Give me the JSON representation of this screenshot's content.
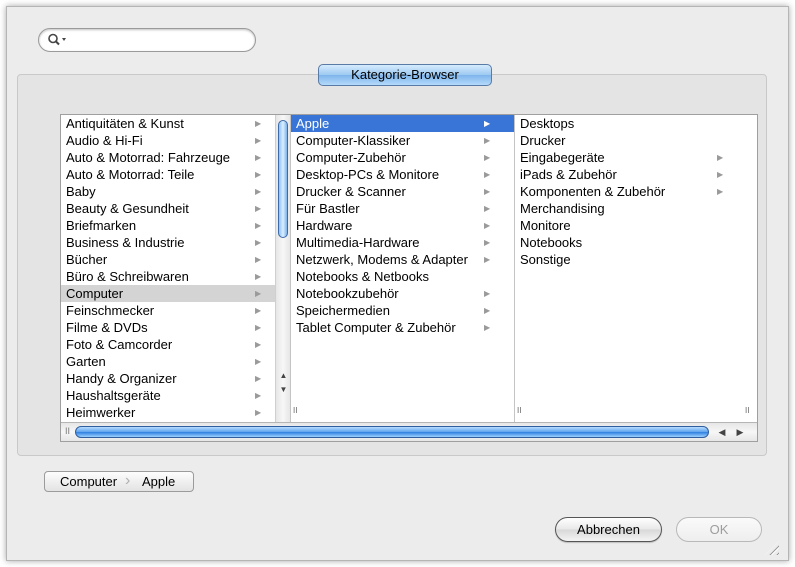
{
  "search": {
    "placeholder": "",
    "value": ""
  },
  "groupbox": {
    "title": "Kategorie-Browser"
  },
  "columns": {
    "col1": [
      {
        "label": "Antiquitäten & Kunst",
        "arrow": "▶"
      },
      {
        "label": "Audio & Hi-Fi",
        "arrow": "▶"
      },
      {
        "label": "Auto & Motorrad: Fahrzeuge",
        "arrow": "▶"
      },
      {
        "label": "Auto & Motorrad: Teile",
        "arrow": "▶"
      },
      {
        "label": "Baby",
        "arrow": "▶"
      },
      {
        "label": "Beauty & Gesundheit",
        "arrow": "▶"
      },
      {
        "label": "Briefmarken",
        "arrow": "▶"
      },
      {
        "label": "Business & Industrie",
        "arrow": "▶"
      },
      {
        "label": "Bücher",
        "arrow": "▶"
      },
      {
        "label": "Büro & Schreibwaren",
        "arrow": "▶"
      },
      {
        "label": "Computer",
        "arrow": "▶"
      },
      {
        "label": "Feinschmecker",
        "arrow": "▶"
      },
      {
        "label": "Filme & DVDs",
        "arrow": "▶"
      },
      {
        "label": "Foto & Camcorder",
        "arrow": "▶"
      },
      {
        "label": "Garten",
        "arrow": "▶"
      },
      {
        "label": "Handy & Organizer",
        "arrow": "▶"
      },
      {
        "label": "Haushaltsgeräte",
        "arrow": "▶"
      },
      {
        "label": "Heimwerker",
        "arrow": "▶"
      }
    ],
    "col2": [
      {
        "label": "Apple",
        "arrow": "▶"
      },
      {
        "label": "Computer-Klassiker",
        "arrow": "▶"
      },
      {
        "label": "Computer-Zubehör",
        "arrow": "▶"
      },
      {
        "label": "Desktop-PCs & Monitore",
        "arrow": "▶"
      },
      {
        "label": "Drucker & Scanner",
        "arrow": "▶"
      },
      {
        "label": "Für Bastler",
        "arrow": "▶"
      },
      {
        "label": "Hardware",
        "arrow": "▶"
      },
      {
        "label": "Multimedia-Hardware",
        "arrow": "▶"
      },
      {
        "label": "Netzwerk, Modems & Adapter",
        "arrow": "▶"
      },
      {
        "label": "Notebooks & Netbooks",
        "arrow": ""
      },
      {
        "label": "Notebookzubehör",
        "arrow": "▶"
      },
      {
        "label": "Speichermedien",
        "arrow": "▶"
      },
      {
        "label": "Tablet Computer & Zubehör",
        "arrow": "▶"
      }
    ],
    "col3": [
      {
        "label": "Desktops",
        "arrow": ""
      },
      {
        "label": "Drucker",
        "arrow": ""
      },
      {
        "label": "Eingabegeräte",
        "arrow": "▶"
      },
      {
        "label": "iPads & Zubehör",
        "arrow": "▶"
      },
      {
        "label": "Komponenten & Zubehör",
        "arrow": "▶"
      },
      {
        "label": "Merchandising",
        "arrow": ""
      },
      {
        "label": "Monitore",
        "arrow": ""
      },
      {
        "label": "Notebooks",
        "arrow": ""
      },
      {
        "label": "Sonstige",
        "arrow": ""
      }
    ],
    "selected_col1": "Computer",
    "selected_col2": "Apple"
  },
  "path": {
    "seg1": "Computer",
    "seg2": "Apple"
  },
  "buttons": {
    "cancel": "Abbrechen",
    "ok": "OK"
  },
  "glyphs": {
    "grip": "II",
    "up": "▲",
    "down": "▼",
    "left": "◀",
    "right": "▶",
    "chevron": "›"
  }
}
